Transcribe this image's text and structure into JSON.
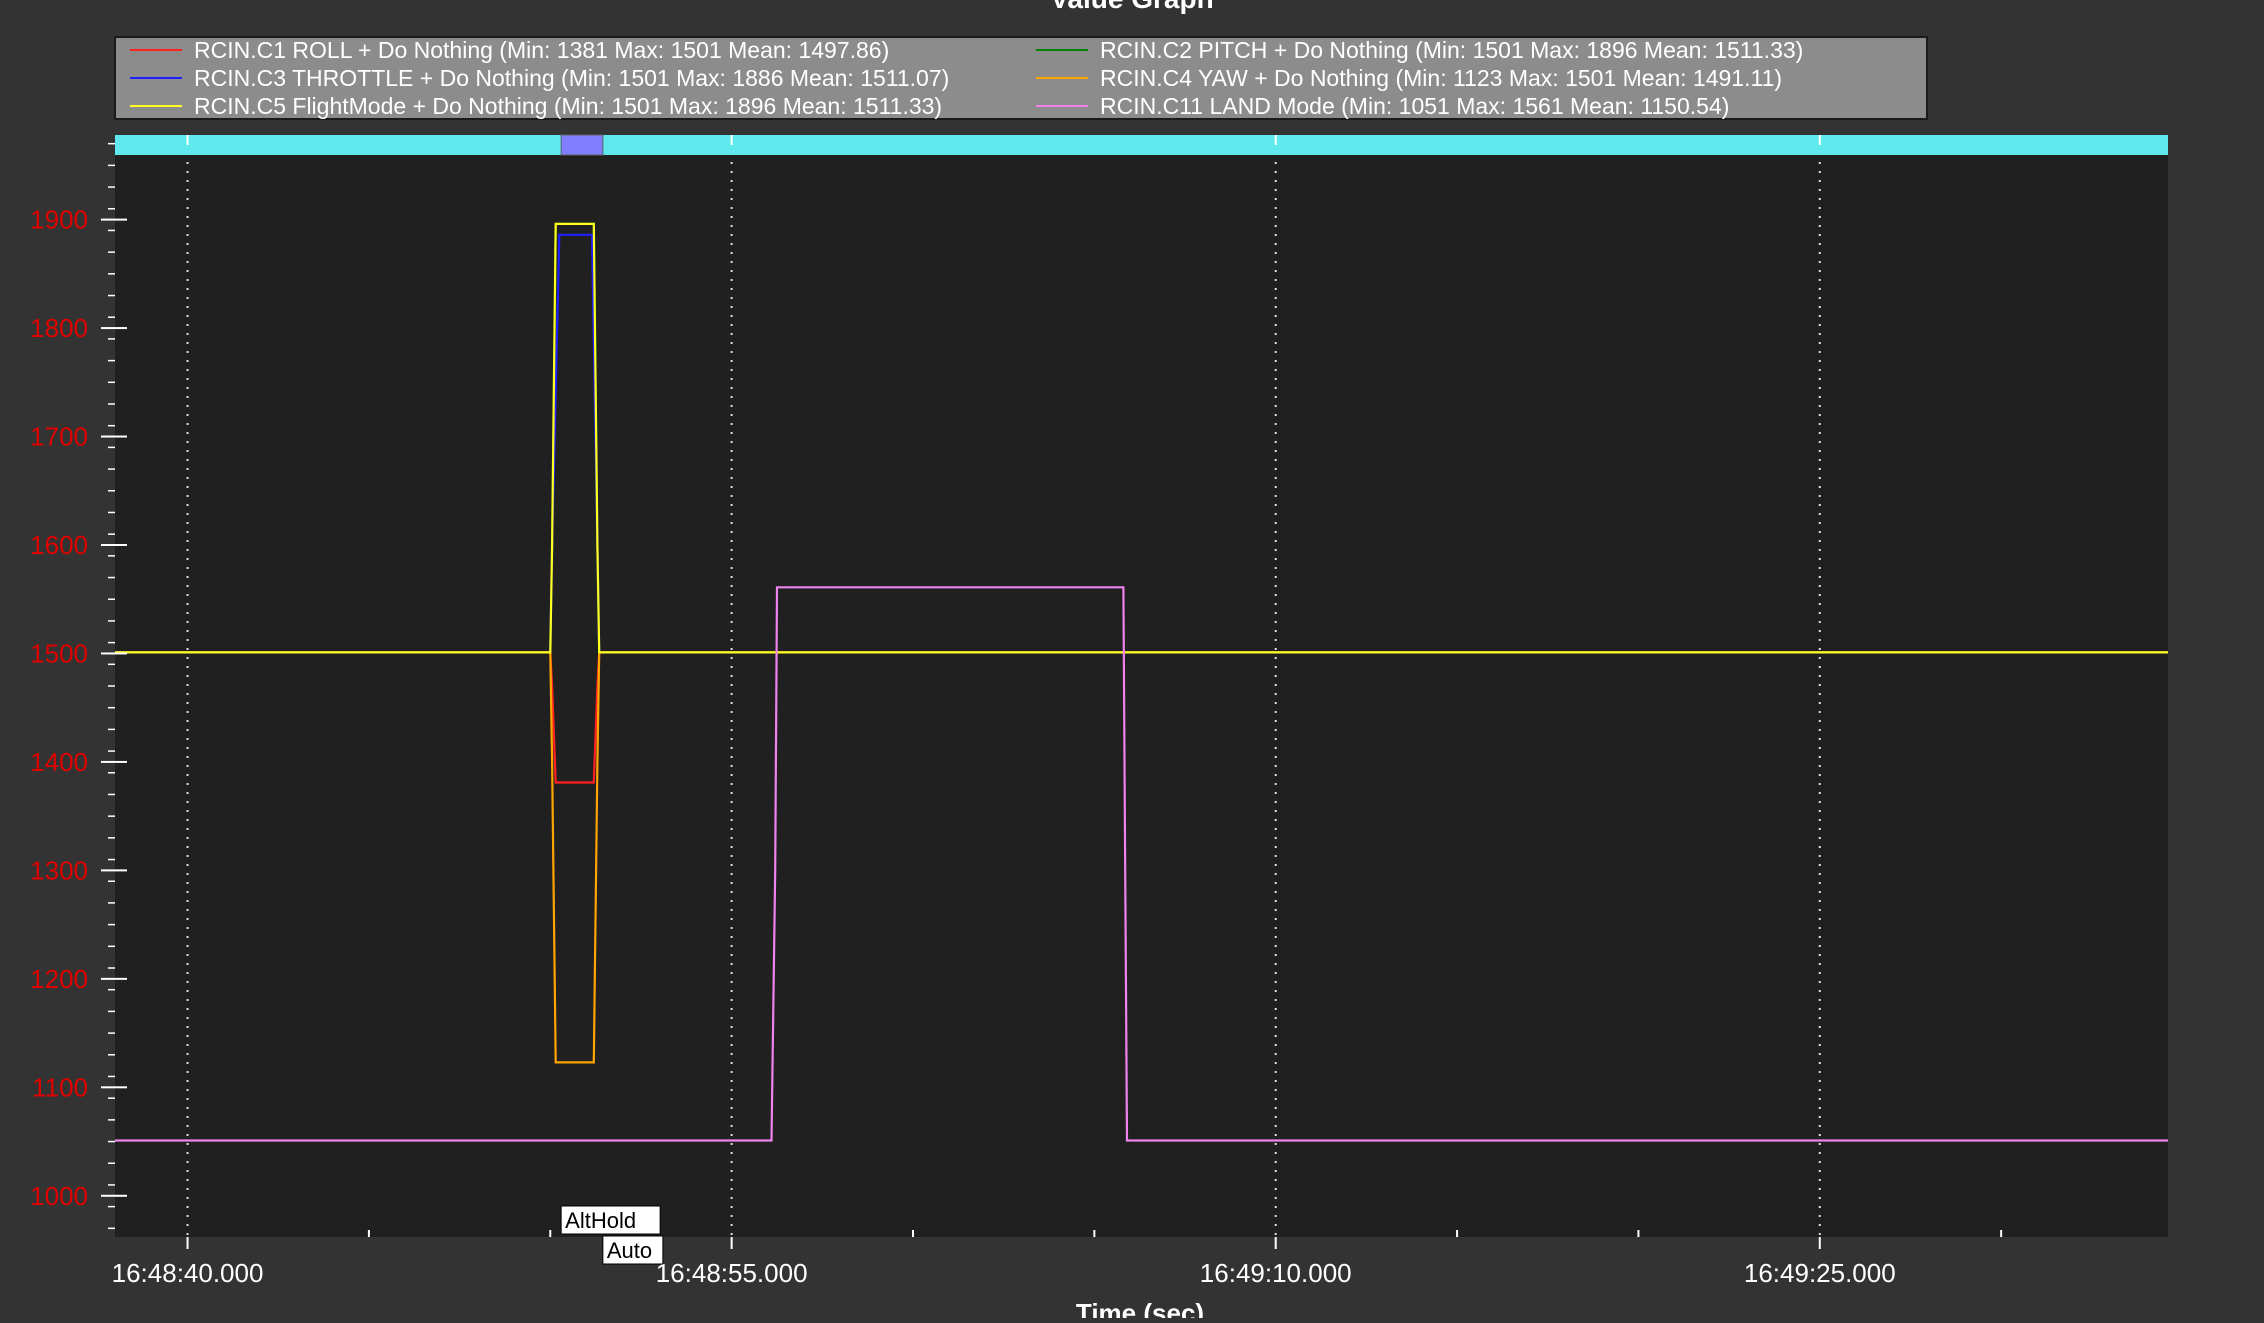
{
  "chart_data": {
    "type": "line",
    "title": "Value Graph",
    "xlabel": "Time (sec)",
    "ylabel": "",
    "x_unit": "time (HH:MM:SS)",
    "xlim": [
      "16:48:38.000",
      "16:49:34.600"
    ],
    "ylim": [
      962,
      1978
    ],
    "x_ticks": [
      "16:48:40.000",
      "16:48:55.000",
      "16:49:10.000",
      "16:49:25.000"
    ],
    "y_ticks": [
      1000,
      1100,
      1200,
      1300,
      1400,
      1500,
      1600,
      1700,
      1800,
      1900
    ],
    "grid": "vertical dotted at major x ticks",
    "legend_position": "top",
    "colors": {
      "background": "#333333",
      "plot_area": "#202020",
      "legend_box": "#8c8c8c",
      "mode_bar": "#5fe9ee",
      "mode_bar_highlight": "#8080ff",
      "y_tick_labels": "#e00000",
      "text": "#ffffff"
    },
    "series": [
      {
        "name": "RCIN.C1 ROLL + Do Nothing",
        "legend": "RCIN.C1 ROLL + Do Nothing (Min: 1381 Max: 1501 Mean: 1497.86)",
        "color": "#ff2020",
        "points": [
          [
            "16:48:38.000",
            1501
          ],
          [
            "16:48:50.000",
            1501
          ],
          [
            "16:48:50.050",
            1470
          ],
          [
            "16:48:50.150",
            1381
          ],
          [
            "16:48:51.200",
            1381
          ],
          [
            "16:48:51.300",
            1470
          ],
          [
            "16:48:51.350",
            1501
          ],
          [
            "16:49:34.600",
            1501
          ]
        ]
      },
      {
        "name": "RCIN.C2 PITCH + Do Nothing",
        "legend": "RCIN.C2 PITCH + Do Nothing (Min: 1501 Max: 1896 Mean: 1511.33)",
        "color": "#008000",
        "points": [
          [
            "16:48:38.000",
            1501
          ],
          [
            "16:48:50.000",
            1501
          ],
          [
            "16:48:50.050",
            1600
          ],
          [
            "16:48:50.150",
            1896
          ],
          [
            "16:48:51.200",
            1896
          ],
          [
            "16:48:51.300",
            1600
          ],
          [
            "16:48:51.350",
            1501
          ],
          [
            "16:49:34.600",
            1501
          ]
        ]
      },
      {
        "name": "RCIN.C3 THROTTLE + Do Nothing",
        "legend": "RCIN.C3 THROTTLE + Do Nothing (Min: 1501 Max: 1886 Mean: 1511.07)",
        "color": "#2020ff",
        "points": [
          [
            "16:48:38.000",
            1501
          ],
          [
            "16:48:50.000",
            1501
          ],
          [
            "16:48:50.050",
            1600
          ],
          [
            "16:48:50.250",
            1886
          ],
          [
            "16:48:51.150",
            1886
          ],
          [
            "16:48:51.300",
            1600
          ],
          [
            "16:48:51.350",
            1501
          ],
          [
            "16:49:34.600",
            1501
          ]
        ]
      },
      {
        "name": "RCIN.C4 YAW + Do Nothing",
        "legend": "RCIN.C4 YAW + Do Nothing (Min: 1123 Max: 1501 Mean: 1491.11)",
        "color": "#ffa500",
        "points": [
          [
            "16:48:38.000",
            1501
          ],
          [
            "16:48:50.000",
            1501
          ],
          [
            "16:48:50.050",
            1400
          ],
          [
            "16:48:50.150",
            1123
          ],
          [
            "16:48:51.200",
            1123
          ],
          [
            "16:48:51.300",
            1400
          ],
          [
            "16:48:51.350",
            1501
          ],
          [
            "16:49:34.600",
            1501
          ]
        ]
      },
      {
        "name": "RCIN.C5 FlightMode + Do Nothing",
        "legend": "RCIN.C5 FlightMode + Do Nothing (Min: 1501 Max: 1896 Mean: 1511.33)",
        "color": "#ffff20",
        "points": [
          [
            "16:48:38.000",
            1501
          ],
          [
            "16:48:50.000",
            1501
          ],
          [
            "16:48:50.050",
            1600
          ],
          [
            "16:48:50.150",
            1896
          ],
          [
            "16:48:51.200",
            1896
          ],
          [
            "16:48:51.300",
            1600
          ],
          [
            "16:48:51.350",
            1501
          ],
          [
            "16:49:34.600",
            1501
          ]
        ]
      },
      {
        "name": "RCIN.C11 LAND Mode",
        "legend": "RCIN.C11 LAND Mode (Min: 1051 Max: 1561 Mean: 1150.54)",
        "color": "#ee82ee",
        "points": [
          [
            "16:48:38.000",
            1051
          ],
          [
            "16:48:56.100",
            1051
          ],
          [
            "16:48:56.200",
            1300
          ],
          [
            "16:48:56.250",
            1561
          ],
          [
            "16:49:05.800",
            1561
          ],
          [
            "16:49:05.850",
            1300
          ],
          [
            "16:49:05.900",
            1051
          ],
          [
            "16:49:34.600",
            1051
          ]
        ]
      }
    ],
    "mode_segments": [
      {
        "mode": "AltHold",
        "start": "16:48:50.300",
        "end": "16:48:51.450",
        "highlight": true
      },
      {
        "mode": "Auto",
        "start": "16:48:51.450",
        "end": "16:49:34.600",
        "highlight": false
      }
    ],
    "annotations": [
      {
        "text": "AltHold",
        "x": "16:48:50.300",
        "row": 1
      },
      {
        "text": "Auto",
        "x": "16:48:51.450",
        "row": 2
      }
    ]
  }
}
